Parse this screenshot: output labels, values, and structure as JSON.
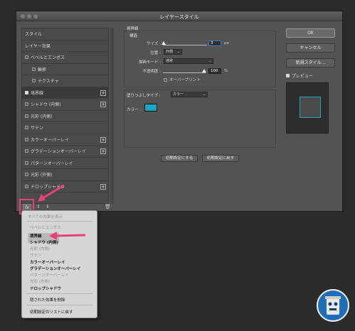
{
  "dialog": {
    "title": "レイヤースタイル"
  },
  "left_list": [
    {
      "label": "スタイル",
      "checkbox": false,
      "indent": false,
      "plus": false
    },
    {
      "label": "レイヤー効果",
      "checkbox": false,
      "indent": false,
      "plus": false
    },
    {
      "label": "ベベルとエンボス",
      "checkbox": true,
      "checked": false,
      "indent": false,
      "plus": false
    },
    {
      "label": "輪郭",
      "checkbox": true,
      "checked": false,
      "indent": true,
      "plus": false
    },
    {
      "label": "テクスチャ",
      "checkbox": true,
      "checked": false,
      "indent": true,
      "plus": false
    },
    {
      "label": "境界線",
      "checkbox": true,
      "checked": true,
      "indent": false,
      "plus": true,
      "selected": true
    },
    {
      "label": "シャドウ (内側)",
      "checkbox": true,
      "checked": false,
      "indent": false,
      "plus": true
    },
    {
      "label": "光彩 (内側)",
      "checkbox": true,
      "checked": false,
      "indent": false,
      "plus": false
    },
    {
      "label": "サテン",
      "checkbox": true,
      "checked": false,
      "indent": false,
      "plus": false
    },
    {
      "label": "カラーオーバーレイ",
      "checkbox": true,
      "checked": false,
      "indent": false,
      "plus": true
    },
    {
      "label": "グラデーションオーバーレイ",
      "checkbox": true,
      "checked": false,
      "indent": false,
      "plus": true
    },
    {
      "label": "パターンオーバーレイ",
      "checkbox": true,
      "checked": false,
      "indent": false,
      "plus": false
    },
    {
      "label": "光彩 (外側)",
      "checkbox": true,
      "checked": false,
      "indent": false,
      "plus": false
    },
    {
      "label": "ドロップシャドウ",
      "checkbox": true,
      "checked": false,
      "indent": false,
      "plus": true
    }
  ],
  "bottom_bar": {
    "fx_label": "fx",
    "up": "⬆",
    "down": "⬇",
    "trash": "🗑"
  },
  "stroke": {
    "section_title": "境界線",
    "structure_title": "構造",
    "size_label": "サイズ :",
    "size_value": "3",
    "size_unit": "px",
    "position_label": "位置 :",
    "position_value": "外側",
    "blend_label": "描画モード :",
    "blend_value": "通常",
    "opacity_label": "不透明度 :",
    "opacity_value": "100",
    "opacity_unit": "%",
    "overprint_label": "オーバープリント",
    "fill_type_label": "塗りつぶしタイプ :",
    "fill_type_value": "カラー",
    "color_label": "カラー :",
    "color": "#1aa6c0",
    "make_default": "初期設定にする",
    "reset_default": "初期設定に戻す"
  },
  "right": {
    "ok": "OK",
    "cancel": "キャンセル",
    "new_style": "新規スタイル...",
    "preview": "プレビュー"
  },
  "menu": {
    "items": [
      {
        "label": "すべての効果を表示",
        "style": "first"
      },
      {
        "label": "ベベルとエンボス",
        "style": "dis"
      },
      {
        "label": "境界線",
        "style": "bold"
      },
      {
        "label": "シャドウ (内側)",
        "style": "bold"
      },
      {
        "label": "光彩 (内側)",
        "style": "dis"
      },
      {
        "label": "サテン",
        "style": "dis"
      },
      {
        "label": "カラーオーバーレイ",
        "style": "bold"
      },
      {
        "label": "グラデーションオーバーレイ",
        "style": "bold"
      },
      {
        "label": "パターンオーバーレイ",
        "style": "dis"
      },
      {
        "label": "光彩 (外側)",
        "style": "dis"
      },
      {
        "label": "ドロップシャドウ",
        "style": "bold"
      },
      {
        "label": "隠された効果を削除",
        "style": "normal"
      },
      {
        "label": "初期設定のリストに戻す",
        "style": "normal"
      }
    ]
  },
  "colors": {
    "accent_pink": "#e8417a",
    "swatch": "#1aa6c0"
  }
}
